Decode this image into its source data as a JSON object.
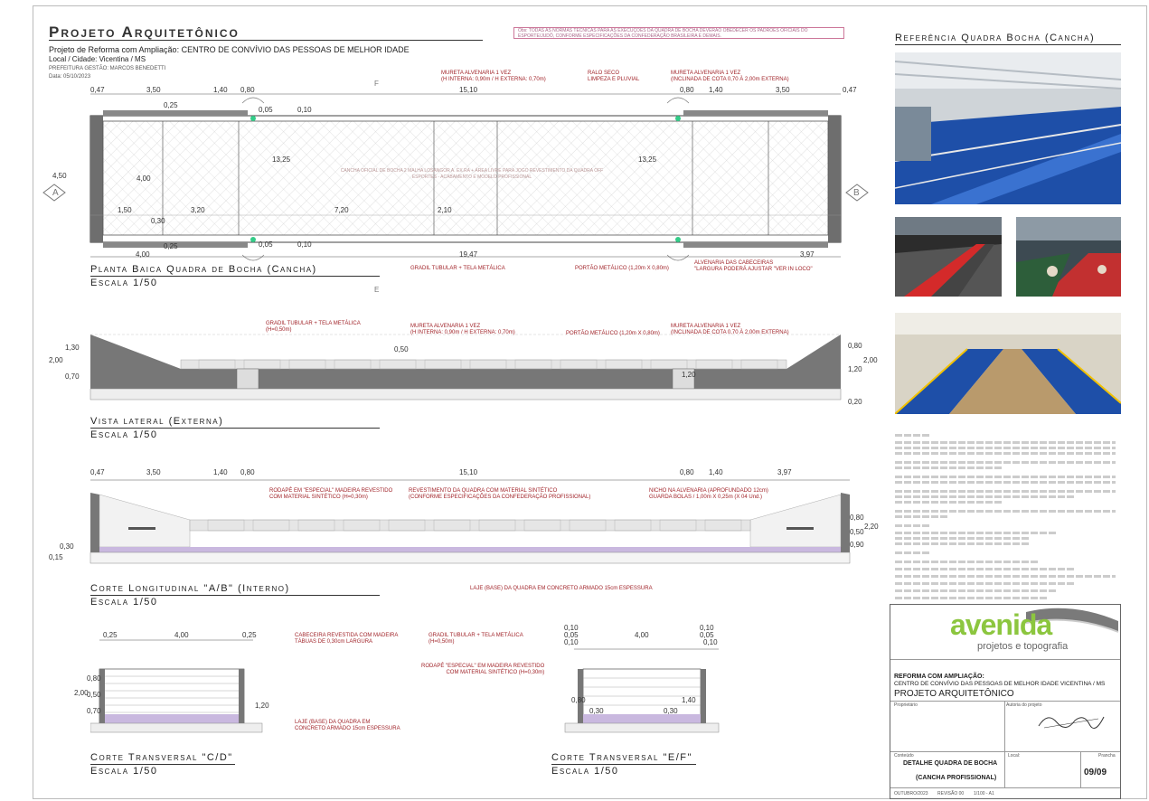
{
  "header": {
    "title": "Projeto Arquitetônico",
    "project_line": "Projeto de Reforma com Ampliação: CENTRO DE CONVÍVIO DAS PESSOAS DE MELHOR IDADE",
    "location": "Local / Cidade: Vicentina / MS",
    "office": "PREFEITURA GESTÃO: MARCOS BENEDETTI",
    "date": "Data: 05/10/2023",
    "note": "Obs: TODAS AS NORMAS TÉCNICAS PARA AS EXECUÇÕES DA QUADRA DE BOCHA DEVERÃO OBEDECER OS PADRÕES OFICIAIS DO ESPORTE/JUDÔ, CONFORME ESPECIFICAÇÕES DA CONFEDERAÇÃO BRASILEIRA E DEMAIS."
  },
  "plan": {
    "caption": "Planta Baica Quadra de Bocha (Cancha)",
    "scale": "Escala 1/50",
    "dims_top": [
      "0,47",
      "3,50",
      "1,40",
      "0,80",
      "15,10",
      "0,80",
      "1,40",
      "3,50",
      "0,47"
    ],
    "dims_inner": [
      "13,25",
      "13,25",
      "7,20",
      "2,10",
      "1,50",
      "3,20",
      "0,30",
      "4,50",
      "4,00",
      "0,25",
      "0,05",
      "0,10"
    ],
    "dims_bottom": [
      "4,00",
      "0,25",
      "0,05",
      "0,10",
      "19,47",
      "3,97"
    ],
    "center_text": "CANCHA OFICIAL DE BOCHA 2 MALHA LOSANGOR A. EX.RA + ÁREA LIVRE PARA JOGO REVESTIMENTO DA QUADRA OFF ESPORTES - ACABAMENTO E MODELO PROFISSIONAL",
    "section_a": "A",
    "section_b": "B",
    "section_e": "E",
    "section_f": "F",
    "notes": {
      "mureta1": "MURETA ALVENARIA 1 VEZ\n(H INTERNA: 0,90m / H EXTERNA: 0,70m)",
      "ralo": "RALO SECO\nLIMPEZA E PLUVIAL",
      "mureta2": "MURETA ALVENARIA 1 VEZ\n(INCLINADA DE COTA 0,70 À 2,00m EXTERNA)",
      "gradil": "GRADIL TUBULAR + TELA METÁLICA",
      "portao": "PORTÃO METÁLICO (1,20m X 0,80m)",
      "alvenaria": "ALVENARIA DAS CABECEIRAS\n\"LARGURA PODERÁ AJUSTAR \"VER IN LOCO\""
    }
  },
  "lateral": {
    "caption": "Vista lateral (Externa)",
    "scale": "Escala 1/50",
    "dims": [
      "2,00",
      "1,30",
      "0,70",
      "0,50",
      "1,20",
      "0,80",
      "1,20",
      "2,00",
      "0,20"
    ],
    "notes": {
      "gradil": "GRADIL TUBULAR + TELA METÁLICA\n(H=0,50m)",
      "mureta1": "MURETA ALVENARIA 1 VEZ\n(H INTERNA: 0,90m / H EXTERNA: 0,70m)",
      "portao": "PORTÃO METÁLICO (1,20m X 0,80m)",
      "mureta2": "MURETA ALVENARIA 1 VEZ\n(INCLINADA DE COTA 0,70 À 2,00m EXTERNA)"
    }
  },
  "longitudinal": {
    "caption": "Corte Longitudinal \"A/B\" (Interno)",
    "scale": "Escala 1/50",
    "dims_top": [
      "0,47",
      "3,50",
      "1,40",
      "0,80",
      "15,10",
      "0,80",
      "1,40",
      "3,97"
    ],
    "dims_side": [
      "0,15",
      "0,30",
      "0,80",
      "0,90",
      "0,50",
      "2,20"
    ],
    "notes": {
      "rodape": "RODAPÉ EM \"ESPECIAL\" MADEIRA REVESTIDO\nCOM MATERIAL SINTÉTICO (H=0,30m)",
      "revestimento": "REVESTIMENTO DA QUADRA COM MATERIAL SINTÉTICO\n(CONFORME ESPECIFICAÇÕES DA CONFEDERAÇÃO PROFISSIONAL)",
      "nicho": "NICHO NA ALVENARIA (APROFUNDADO 12cm)\nGUARDA BOLAS / 1,00m X 0,25m (X 04 Und.)",
      "laje": "LAJE (BASE) DA QUADRA EM CONCRETO ARMADO 15cm ESPESSURA"
    }
  },
  "transversal_cd": {
    "caption": "Corte Transversal \"C/D\"",
    "scale": "Escala 1/50",
    "dims": [
      "0,25",
      "4,00",
      "0,25",
      "2,00",
      "0,80",
      "0,50",
      "0,70",
      "1,20"
    ],
    "notes": {
      "cabeceira": "CABECEIRA REVESTIDA COM MADEIRA\nTÁBUAS DE 0,30cm LARGURA",
      "laje": "LAJE (BASE) DA QUADRA EM\nCONCRETO ARMADO 15cm ESPESSURA"
    }
  },
  "transversal_ef": {
    "caption": "Corte Transversal \"E/F\"",
    "scale": "Escala 1/50",
    "dims": [
      "0,10",
      "0,05",
      "0,10",
      "4,00",
      "0,10",
      "0,05",
      "0,10",
      "0,80",
      "0,30",
      "0,30",
      "1,40"
    ],
    "notes": {
      "gradil": "GRADIL TUBULAR + TELA METÁLICA\n(H=0,50m)",
      "rodape": "RODAPÉ \"ESPECIAL\" EM MADEIRA REVESTIDO\nCOM MATERIAL SINTÉTICO (H=0,30m)"
    }
  },
  "reference": {
    "title": "Referência Quadra Bocha (Cancha)"
  },
  "title_block": {
    "logo_main": "avenida",
    "logo_sub": "projetos e topografia",
    "project_label": "REFORMA COM AMPLIAÇÃO:",
    "project_name": "CENTRO DE CONVÍVIO DAS PESSOAS DE MELHOR IDADE VICENTINA / MS",
    "project_type": "PROJETO ARQUITETÔNICO",
    "proprietario": "Proprietário",
    "autoria": "Autoria do projeto",
    "conteudo": "Conteúdo",
    "sheet_title_1": "DETALHE QUADRA DE BOCHA",
    "sheet_title_2": "(CANCHA PROFISSIONAL)",
    "sheet_number": "09/09",
    "prancha": "Prancha",
    "local_label": "Local:",
    "date_label": "OUTUBRO/2023",
    "revision": "REVISÃO 00",
    "scale_label": "1/100 - A1"
  },
  "colors": {
    "annotation": "#a1242a",
    "wall": "#6e6e6e",
    "floor_purple": "#c9b8df",
    "court_blue": "#1e4fa8",
    "logo_green": "#8cc63f"
  }
}
